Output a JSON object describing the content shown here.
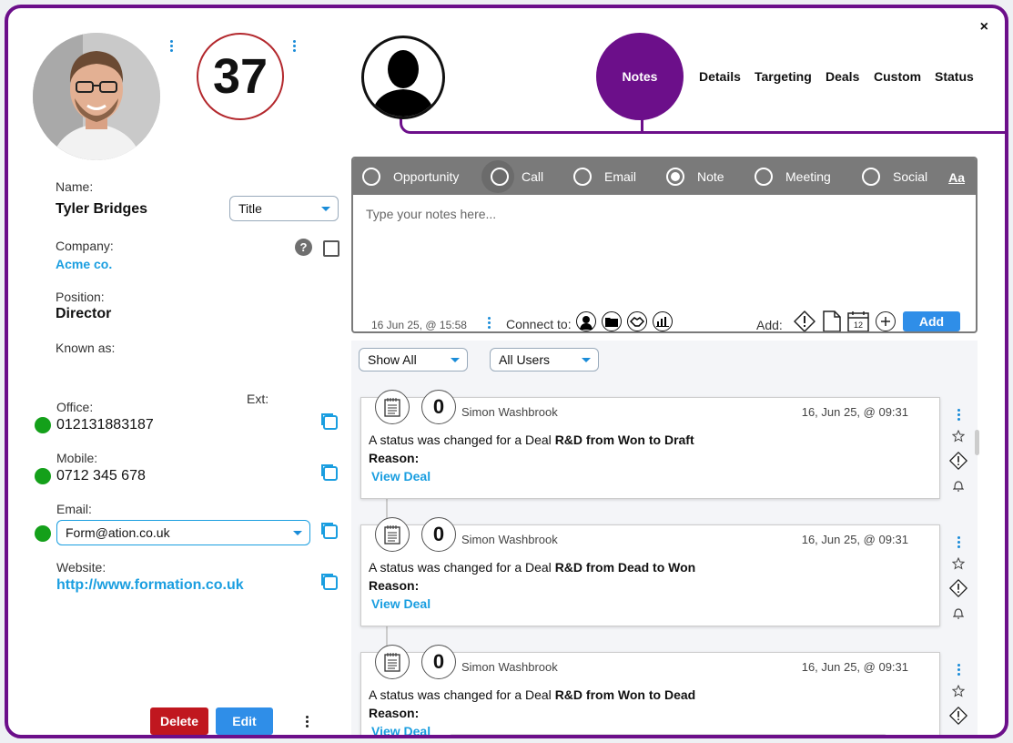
{
  "close_label": "×",
  "contact": {
    "score": "37",
    "name_label": "Name:",
    "name": "Tyler Bridges",
    "title_select": "Title",
    "company_label": "Company:",
    "company": "Acme co.",
    "help_icon": "?",
    "position_label": "Position:",
    "position": "Director",
    "known_as_label": "Known as:",
    "office_label": "Office:",
    "ext_label": "Ext:",
    "office": "012131883187",
    "mobile_label": "Mobile:",
    "mobile": "0712 345 678",
    "email_label": "Email:",
    "email": "Form@ation.co.uk",
    "website_label": "Website:",
    "website": "http://www.formation.co.uk"
  },
  "actions": {
    "delete": "Delete",
    "edit": "Edit"
  },
  "tabs": {
    "active": "Notes",
    "items": [
      "Details",
      "Targeting",
      "Deals",
      "Custom",
      "Status"
    ]
  },
  "composer": {
    "types": [
      "Opportunity",
      "Call",
      "Email",
      "Note",
      "Meeting",
      "Social"
    ],
    "selected": "Note",
    "font_toggle": "Aa",
    "placeholder": "Type your notes here...",
    "timestamp": "16 Jun 25, @ 15:58",
    "connect_label": "Connect to:",
    "add_label": "Add:",
    "calendar_day": "12",
    "add_button": "Add"
  },
  "filters": {
    "show": "Show All",
    "users": "All Users"
  },
  "feed": [
    {
      "count": "0",
      "user": "Simon Washbrook",
      "time": "16, Jun 25, @ 09:31",
      "msg_prefix": "A status was changed for a Deal ",
      "msg_bold": "R&D from Won to Draft",
      "reason": "Reason:",
      "link": "View Deal"
    },
    {
      "count": "0",
      "user": "Simon Washbrook",
      "time": "16, Jun 25, @ 09:31",
      "msg_prefix": "A status was changed for a Deal ",
      "msg_bold": "R&D from Dead to Won",
      "reason": "Reason:",
      "link": "View Deal"
    },
    {
      "count": "0",
      "user": "Simon Washbrook",
      "time": "16, Jun 25, @ 09:31",
      "msg_prefix": "A status was changed for a Deal ",
      "msg_bold": "R&D from Won to Dead",
      "reason": "Reason:",
      "link": "View Deal"
    }
  ],
  "colors": {
    "brand": "#6c0f8a",
    "accent": "#1a9ee0",
    "delete": "#c0171f",
    "edit": "#2f8ee8",
    "status_online": "#14a01a"
  }
}
